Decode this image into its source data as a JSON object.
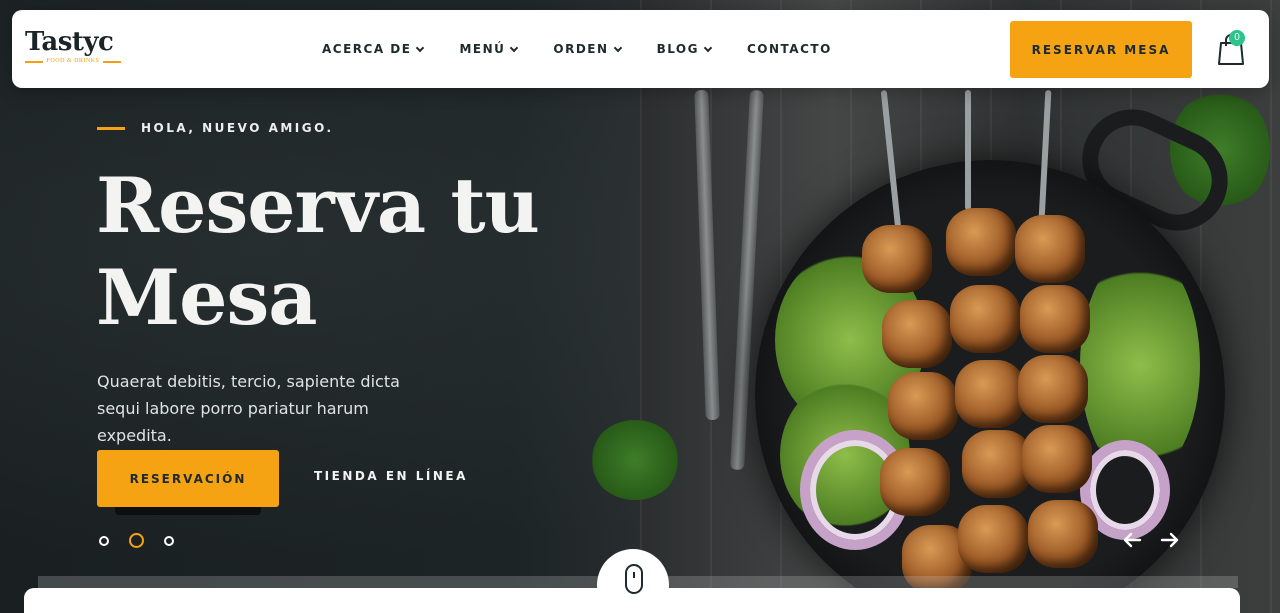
{
  "brand": {
    "name": "Tastyc",
    "tagline": "FOOD & DRINKS"
  },
  "nav": {
    "items": [
      {
        "label": "ACERCA DE",
        "has_dropdown": true
      },
      {
        "label": "MENÚ",
        "has_dropdown": true
      },
      {
        "label": "ORDEN",
        "has_dropdown": true
      },
      {
        "label": "BLOG",
        "has_dropdown": true
      },
      {
        "label": "CONTACTO",
        "has_dropdown": false
      }
    ],
    "reserve_label": "RESERVAR MESA",
    "cart_count": "0"
  },
  "hero": {
    "eyebrow": "HOLA, NUEVO AMIGO.",
    "title": "Reserva tu Mesa",
    "description": "Quaerat debitis, tercio, sapiente dicta sequi labore porro pariatur harum expedita.",
    "primary_button": "RESERVACIÓN",
    "secondary_link": "TIENDA EN LÍNEA",
    "slides": 3,
    "active_slide": 2
  },
  "colors": {
    "accent": "#f5a213",
    "dark": "#1d2a2e",
    "badge": "#2bc48a"
  },
  "icons": {
    "cart": "shopping-bag-icon",
    "prev": "arrow-left-icon",
    "next": "arrow-right-icon",
    "scroll": "mouse-scroll-icon"
  }
}
